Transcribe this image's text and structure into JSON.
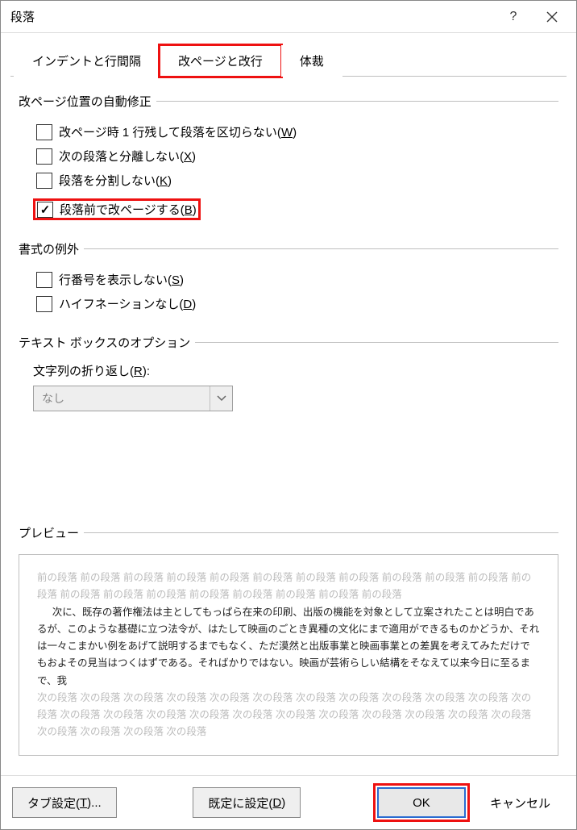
{
  "titlebar": {
    "title": "段落"
  },
  "tabs": [
    {
      "label": "インデントと行間隔"
    },
    {
      "label": "改ページと改行"
    },
    {
      "label": "体裁"
    }
  ],
  "group_pagebreak": {
    "legend": "改ページ位置の自動修正",
    "widow": {
      "pre": "改ページ時 1 行残して段落を区切らない(",
      "key": "W",
      "post": ")"
    },
    "keepnext": {
      "pre": "次の段落と分離しない(",
      "key": "X",
      "post": ")"
    },
    "keeptog": {
      "pre": "段落を分割しない(",
      "key": "K",
      "post": ")"
    },
    "before": {
      "pre": "段落前で改ページする(",
      "key": "B",
      "post": ")"
    }
  },
  "group_format": {
    "legend": "書式の例外",
    "linenum": {
      "pre": "行番号を表示しない(",
      "key": "S",
      "post": ")"
    },
    "hyph": {
      "pre": "ハイフネーションなし(",
      "key": "D",
      "post": ")"
    }
  },
  "group_textbox": {
    "legend": "テキスト ボックスのオプション",
    "wrap": {
      "pre": "文字列の折り返し(",
      "key": "R",
      "post": "):"
    },
    "combo_value": "なし"
  },
  "preview": {
    "legend": "プレビュー",
    "prev_para": "前の段落 前の段落 前の段落 前の段落 前の段落 前の段落 前の段落 前の段落 前の段落 前の段落 前の段落 前の段落 前の段落 前の段落 前の段落 前の段落 前の段落 前の段落 前の段落 前の段落",
    "body": "次に、既存の著作権法は主としてもっぱら在来の印刷、出版の機能を対象として立案されたことは明白であるが、このような基礎に立つ法令が、はたして映画のごとき異種の文化にまで適用ができるものかどうか、それは一々こまかい例をあげて説明するまでもなく、ただ漠然と出版事業と映画事業との差異を考えてみただけでもおよその見当はつくはずである。そればかりではない。映画が芸術らしい結構をそなえて以来今日に至るまで、我",
    "next_para": "次の段落 次の段落 次の段落 次の段落 次の段落 次の段落 次の段落 次の段落 次の段落 次の段落 次の段落 次の段落 次の段落 次の段落 次の段落 次の段落 次の段落 次の段落 次の段落 次の段落 次の段落 次の段落 次の段落 次の段落 次の段落 次の段落 次の段落"
  },
  "footer": {
    "tabs": {
      "pre": "タブ設定(",
      "key": "T",
      "post": ")..."
    },
    "default": {
      "pre": "既定に設定(",
      "key": "D",
      "post": ")"
    },
    "ok": "OK",
    "cancel": "キャンセル"
  }
}
